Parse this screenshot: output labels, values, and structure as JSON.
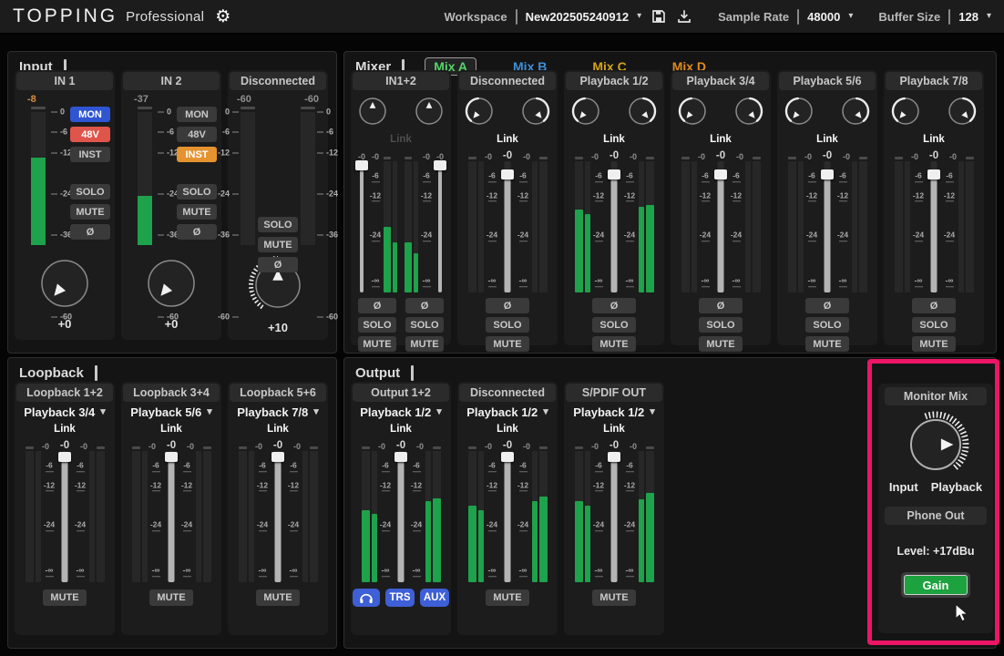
{
  "topbar": {
    "brand": "TOPPING",
    "edition": "Professional",
    "workspace_label": "Workspace",
    "workspace_value": "New202505240912",
    "sample_rate_label": "Sample Rate",
    "sample_rate_value": "48000",
    "buffer_size_label": "Buffer Size",
    "buffer_size_value": "128"
  },
  "strings": {
    "link": "Link"
  },
  "colors": {
    "meter_green": "#1EA24B",
    "highlight_pink": "#EC1566",
    "mon_blue": "#2F55D2",
    "phantom_red": "#DF554B",
    "inst_orange": "#E4932F",
    "output_button_blue": "#3E5FD6",
    "gain_green": "#1CA23E"
  },
  "strip_scale": [
    {
      "label": "-6",
      "pos": 12
    },
    {
      "label": "-12",
      "pos": 27
    },
    {
      "label": "-24",
      "pos": 57
    },
    {
      "label": "-∞",
      "pos": 92
    }
  ],
  "input_scale": [
    {
      "label": "0",
      "pos": 0
    },
    {
      "label": "-6",
      "pos": 10
    },
    {
      "label": "-12",
      "pos": 20
    },
    {
      "label": "-24",
      "pos": 40
    },
    {
      "label": "-36",
      "pos": 60
    },
    {
      "label": "-60",
      "pos": 100
    }
  ],
  "input_panel": {
    "title": "Input",
    "channels": [
      {
        "label": "IN 1",
        "peak": "-8",
        "peak_highlight": true,
        "level": 0.66,
        "toggles": [
          {
            "label": "MON",
            "state": "on-blue"
          },
          {
            "label": "48V",
            "state": "on-red"
          },
          {
            "label": "INST",
            "state": "off"
          }
        ],
        "buttons": [
          "SOLO",
          "MUTE",
          "Ø"
        ],
        "gain": "+0",
        "knob": {
          "pointer": 220,
          "ticks": false
        }
      },
      {
        "label": "IN 2",
        "peak": "-37",
        "peak_highlight": false,
        "level": 0.37,
        "toggles": [
          {
            "label": "MON",
            "state": "off"
          },
          {
            "label": "48V",
            "state": "off"
          },
          {
            "label": "INST",
            "state": "on-orange"
          }
        ],
        "buttons": [
          "SOLO",
          "MUTE",
          "Ø"
        ],
        "gain": "+0",
        "knob": {
          "pointer": 220,
          "ticks": false
        }
      },
      {
        "label": "Disconnected",
        "peaks": [
          "-60",
          "-60"
        ],
        "levels": [
          0,
          0
        ],
        "buttons": [
          "SOLO",
          "MUTE",
          "Ø"
        ],
        "gain": "+10",
        "knob": {
          "pointer": 0,
          "ticks": true
        }
      }
    ]
  },
  "mixer_panel": {
    "title": "Mixer",
    "tabs": [
      {
        "label": "Mix A",
        "color": "#55D46A",
        "active": true
      },
      {
        "label": "Mix B",
        "color": "#3E8FD6",
        "active": false
      },
      {
        "label": "Mix C",
        "color": "#D3A21B",
        "active": false
      },
      {
        "label": "Mix D",
        "color": "#DF8A1F",
        "active": false
      }
    ],
    "channels": [
      {
        "label": "IN1+2",
        "type": "dual",
        "link_on": false,
        "peak_labels": [
          "-0",
          "-0",
          "-0",
          "-0"
        ],
        "meters": [
          0.5,
          0.38,
          0.38,
          0.3
        ],
        "faders": [
          0.03,
          0.03
        ],
        "buttons": [
          "Ø",
          "SOLO",
          "MUTE"
        ]
      },
      {
        "label": "Disconnected",
        "type": "single",
        "link_on": true,
        "pan": true,
        "peak_labels": [
          "-0",
          "-0",
          "-0"
        ],
        "meters": [
          0,
          0,
          0,
          0
        ],
        "fader": 0.1,
        "buttons": [
          "Ø",
          "SOLO",
          "MUTE"
        ]
      },
      {
        "label": "Playback 1/2",
        "type": "single",
        "link_on": true,
        "pan": true,
        "peak_labels": [
          "-0",
          "-0",
          "-0"
        ],
        "meters": [
          0.63,
          0.6,
          0.65,
          0.67
        ],
        "fader": 0.1,
        "buttons": [
          "Ø",
          "SOLO",
          "MUTE"
        ]
      },
      {
        "label": "Playback 3/4",
        "type": "single",
        "link_on": true,
        "pan": true,
        "peak_labels": [
          "-0",
          "-0",
          "-0"
        ],
        "meters": [
          0,
          0,
          0,
          0
        ],
        "fader": 0.1,
        "buttons": [
          "Ø",
          "SOLO",
          "MUTE"
        ]
      },
      {
        "label": "Playback 5/6",
        "type": "single",
        "link_on": true,
        "pan": true,
        "peak_labels": [
          "-0",
          "-0",
          "-0"
        ],
        "meters": [
          0,
          0,
          0,
          0
        ],
        "fader": 0.1,
        "buttons": [
          "Ø",
          "SOLO",
          "MUTE"
        ]
      },
      {
        "label": "Playback 7/8",
        "type": "single",
        "link_on": true,
        "pan": true,
        "peak_labels": [
          "-0",
          "-0",
          "-0"
        ],
        "meters": [
          0,
          0,
          0,
          0
        ],
        "fader": 0.1,
        "buttons": [
          "Ø",
          "SOLO",
          "MUTE"
        ]
      }
    ]
  },
  "loopback_panel": {
    "title": "Loopback",
    "channels": [
      {
        "label": "Loopback 1+2",
        "source": "Playback 3/4",
        "link_on": true,
        "peak_labels": [
          "-0",
          "-0",
          "-0"
        ],
        "meters": [
          0,
          0,
          0,
          0
        ],
        "fader": 0.04,
        "buttons": [
          "MUTE"
        ]
      },
      {
        "label": "Loopback 3+4",
        "source": "Playback 5/6",
        "link_on": true,
        "peak_labels": [
          "-0",
          "-0",
          "-0"
        ],
        "meters": [
          0,
          0,
          0,
          0
        ],
        "fader": 0.04,
        "buttons": [
          "MUTE"
        ]
      },
      {
        "label": "Loopback 5+6",
        "source": "Playback 7/8",
        "link_on": true,
        "peak_labels": [
          "-0",
          "-0",
          "-0"
        ],
        "meters": [
          0,
          0,
          0,
          0
        ],
        "fader": 0.04,
        "buttons": [
          "MUTE"
        ]
      }
    ]
  },
  "output_panel": {
    "title": "Output",
    "channels": [
      {
        "label": "Output 1+2",
        "source": "Playback 1/2",
        "link_on": true,
        "peak_labels": [
          "-0",
          "-0",
          "-0"
        ],
        "meters": [
          0.55,
          0.52,
          0.62,
          0.64
        ],
        "fader": 0.04,
        "buttons": [
          "headphone",
          "TRS",
          "AUX"
        ],
        "blue_buttons": true
      },
      {
        "label": "Disconnected",
        "source": "Playback 1/2",
        "link_on": true,
        "peak_labels": [
          "-0",
          "-0",
          "-0"
        ],
        "meters": [
          0.58,
          0.55,
          0.62,
          0.65
        ],
        "fader": 0.04,
        "buttons": [
          "MUTE"
        ]
      },
      {
        "label": "S/PDIF OUT",
        "source": "Playback 1/2",
        "link_on": true,
        "peak_labels": [
          "-0",
          "-0",
          "-0"
        ],
        "meters": [
          0.62,
          0.58,
          0.63,
          0.68
        ],
        "fader": 0.04,
        "buttons": [
          "MUTE"
        ]
      }
    ],
    "monitor": {
      "title": "Monitor Mix",
      "left_label": "Input",
      "right_label": "Playback",
      "phone_title": "Phone Out",
      "level_text": "Level: +17dBu",
      "gain_label": "Gain"
    }
  }
}
